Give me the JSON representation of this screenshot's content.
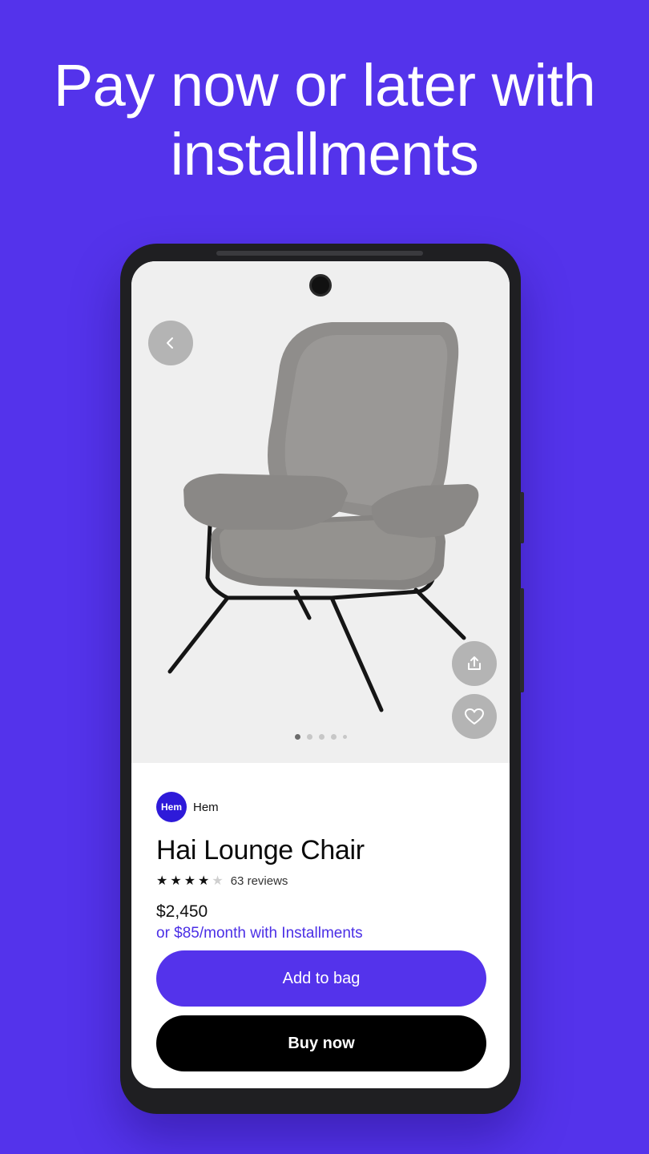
{
  "headline": {
    "line1": "Pay now or later with",
    "line2": "installments"
  },
  "hero": {
    "back_icon": "chevron-left-icon",
    "share_icon": "share-icon",
    "favorite_icon": "heart-icon",
    "image_description_icon": "lounge-chair-image",
    "carousel": {
      "count": 5,
      "active_index": 0
    }
  },
  "product": {
    "brand_logo_text": "Hem",
    "brand_name": "Hem",
    "title": "Hai Lounge Chair",
    "rating": 4,
    "rating_max": 5,
    "reviews": "63 reviews",
    "price": "$2,450",
    "installments": "or $85/month with Installments"
  },
  "actions": {
    "add_to_bag": "Add to bag",
    "buy_now": "Buy now"
  },
  "colors": {
    "background": "#5433EB",
    "accent": "#5433EB",
    "installments_text": "#4B2FE6",
    "buy_button": "#000000"
  }
}
